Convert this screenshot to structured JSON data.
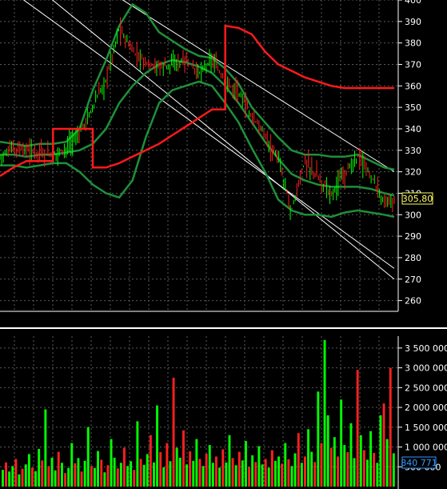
{
  "colors": {
    "background": "#000000",
    "grid": "#5a5a5a",
    "axis": "#ffffff",
    "price_up": "#00ff00",
    "price_down": "#ff2020",
    "bands": "#1f8f3a",
    "stop_line": "#ff1a1a",
    "trendlines": "#ffffff",
    "last_price_badge": "#ffff66",
    "last_volume_badge": "#3399ff"
  },
  "chart_data": [
    {
      "type": "line",
      "panel": "price",
      "ylim": [
        255,
        400
      ],
      "yticks": [
        260,
        270,
        280,
        290,
        300,
        310,
        320,
        330,
        340,
        350,
        360,
        370,
        380,
        390,
        400
      ],
      "ytick_labels": [
        "260",
        "270",
        "280",
        "290",
        "300",
        "310",
        "320",
        "330",
        "340",
        "350",
        "360",
        "370",
        "380",
        "390",
        "400"
      ],
      "x": [
        0,
        4,
        8,
        12,
        16,
        20,
        24,
        28,
        32,
        36,
        40,
        44,
        48,
        52,
        56,
        60,
        64,
        68,
        72,
        76,
        80,
        84,
        88,
        92,
        96,
        100,
        104,
        108,
        112,
        116,
        119
      ],
      "series": [
        {
          "key": "close",
          "values": [
            327,
            331,
            330,
            329,
            328,
            331,
            338,
            350,
            363,
            387,
            376,
            371,
            369,
            370,
            372,
            366,
            372,
            362,
            357,
            346,
            337,
            326,
            302,
            325,
            317,
            310,
            319,
            327,
            318,
            306,
            305.8
          ]
        },
        {
          "key": "upper_band",
          "values": [
            334,
            333,
            332,
            333,
            333,
            334,
            340,
            358,
            372,
            388,
            398,
            394,
            385,
            381,
            377,
            374,
            373,
            368,
            361,
            350,
            343,
            336,
            330,
            328,
            328,
            327,
            327,
            328,
            325,
            322,
            321
          ]
        },
        {
          "key": "middle_band",
          "values": [
            328,
            328,
            327,
            328,
            328,
            329,
            330,
            333,
            340,
            352,
            360,
            366,
            370,
            372,
            371,
            369,
            366,
            360,
            352,
            343,
            334,
            326,
            319,
            316,
            314,
            313,
            313,
            313,
            312,
            310,
            309
          ]
        },
        {
          "key": "lower_band",
          "values": [
            323,
            323,
            322,
            323,
            324,
            324,
            320,
            314,
            310,
            308,
            316,
            336,
            352,
            358,
            360,
            362,
            360,
            352,
            343,
            331,
            320,
            307,
            302,
            300,
            300,
            299,
            301,
            302,
            301,
            300,
            299
          ]
        },
        {
          "key": "stop",
          "values": [
            318,
            322,
            325,
            325,
            340,
            340,
            340,
            322,
            322,
            324,
            327,
            330,
            333,
            337,
            341,
            345,
            349,
            388,
            387,
            384,
            376,
            370,
            367,
            364,
            362,
            360,
            359,
            359,
            359,
            359,
            359
          ]
        }
      ],
      "trendlines": [
        {
          "from": [
            0,
            420
          ],
          "to": [
            119,
            270
          ]
        },
        {
          "from": [
            0,
            408
          ],
          "to": [
            119,
            275
          ]
        },
        {
          "from": [
            35,
            402
          ],
          "to": [
            119,
            320
          ]
        }
      ],
      "last_price": "305,80",
      "grid": true
    },
    {
      "type": "bar",
      "panel": "volume",
      "ylim": [
        0,
        3800000
      ],
      "yticks": [
        500000,
        1000000,
        1500000,
        2000000,
        2500000,
        3000000,
        3500000
      ],
      "ytick_labels": [
        "500 000",
        "1 000 000",
        "1 500 000",
        "2 000 000",
        "2 500 000",
        "3 000 000",
        "3 500 000"
      ],
      "values": [
        420000,
        610000,
        380000,
        520000,
        700000,
        310000,
        450000,
        560000,
        820000,
        480000,
        390000,
        950000,
        660000,
        1950000,
        520000,
        730000,
        410000,
        880000,
        600000,
        340000,
        470000,
        1100000,
        590000,
        720000,
        380000,
        650000,
        1500000,
        520000,
        470000,
        900000,
        680000,
        360000,
        540000,
        1200000,
        730000,
        460000,
        600000,
        980000,
        520000,
        640000,
        420000,
        1650000,
        700000,
        550000,
        820000,
        1300000,
        610000,
        2050000,
        870000,
        490000,
        1100000,
        640000,
        2750000,
        980000,
        730000,
        1420000,
        560000,
        890000,
        650000,
        1200000,
        700000,
        520000,
        830000,
        1050000,
        600000,
        760000,
        480000,
        940000,
        610000,
        1300000,
        720000,
        540000,
        880000,
        660000,
        1150000,
        500000,
        790000,
        620000,
        1020000,
        560000,
        700000,
        480000,
        920000,
        650000,
        760000,
        580000,
        1100000,
        690000,
        520000,
        840000,
        1350000,
        600000,
        760000,
        1450000,
        880000,
        620000,
        2400000,
        1100000,
        3700000,
        1800000,
        980000,
        1250000,
        760000,
        2200000,
        1050000,
        870000,
        1600000,
        720000,
        2950000,
        1300000,
        920000,
        680000,
        1400000,
        850000,
        600000,
        1800000,
        2100000,
        1200000,
        3000000,
        840771
      ],
      "up": [
        true,
        false,
        true,
        true,
        false,
        true,
        false,
        true,
        true,
        false,
        true,
        true,
        false,
        true,
        false,
        true,
        true,
        false,
        true,
        false,
        true,
        true,
        false,
        true,
        false,
        true,
        true,
        false,
        true,
        true,
        false,
        true,
        false,
        true,
        true,
        false,
        true,
        false,
        true,
        true,
        false,
        true,
        false,
        true,
        true,
        false,
        true,
        true,
        false,
        true,
        false,
        true,
        false,
        true,
        true,
        false,
        true,
        false,
        true,
        true,
        false,
        true,
        false,
        true,
        true,
        false,
        true,
        false,
        true,
        true,
        false,
        true,
        false,
        true,
        true,
        false,
        true,
        false,
        true,
        true,
        false,
        true,
        false,
        true,
        true,
        false,
        true,
        false,
        true,
        true,
        false,
        true,
        false,
        true,
        true,
        false,
        true,
        false,
        true,
        true,
        false,
        true,
        false,
        true,
        true,
        false,
        true,
        true,
        false,
        true,
        false,
        true,
        true,
        false,
        true,
        true,
        false,
        true,
        false,
        true
      ],
      "last_volume": "840 771",
      "grid": true
    }
  ]
}
